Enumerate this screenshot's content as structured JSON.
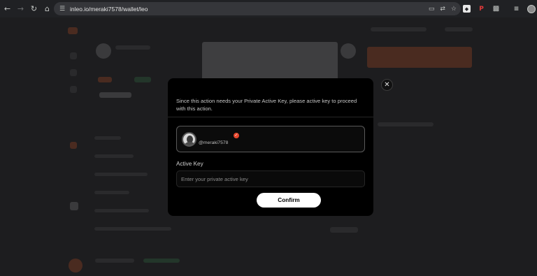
{
  "browser": {
    "url": "inleo.io/meraki7578/wallet/leo",
    "icons": {
      "back": "back-arrow-icon",
      "forward": "forward-arrow-icon",
      "reload": "reload-icon",
      "home": "home-icon",
      "site_info": "site-settings-icon",
      "cast": "cast-icon",
      "translate": "translate-icon",
      "bookmark": "star-icon"
    }
  },
  "modal": {
    "message": "Since this action needs your Private Active Key, please active key to proceed with this action.",
    "account": {
      "username": "@meraki7578",
      "badge_color": "#e5462c"
    },
    "active_key_label": "Active Key",
    "active_key_placeholder": "Enter your private active key",
    "active_key_value": "",
    "confirm_label": "Confirm",
    "close_glyph": "✕"
  },
  "colors": {
    "modal_bg": "#000000",
    "overlay": "#1d1d1f",
    "button_bg": "#ffffff",
    "brand_accent": "#e5462c"
  }
}
